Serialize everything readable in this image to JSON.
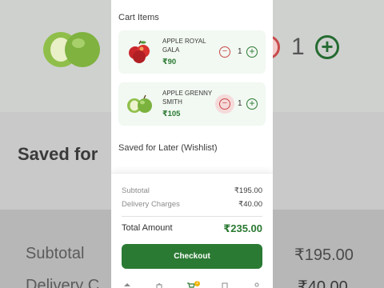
{
  "cart": {
    "section_title": "Cart Items",
    "items": [
      {
        "name": "APPLE ROYAL GALA",
        "price": "₹90",
        "quantity": "1",
        "thumb_icon": "red-apples-icon"
      },
      {
        "name": "APPLE GRENNY SMITH",
        "price": "₹105",
        "quantity": "1",
        "thumb_icon": "green-apples-icon"
      }
    ]
  },
  "wishlist": {
    "section_title": "Saved for Later (Wishlist)"
  },
  "summary": {
    "subtotal_label": "Subtotal",
    "subtotal_value": "₹195.00",
    "delivery_label": "Delivery Charges",
    "delivery_value": "₹40.00",
    "total_label": "Total Amount",
    "total_value": "₹235.00",
    "checkout_label": "Checkout"
  },
  "tabbar": {
    "tabs": [
      "home-icon",
      "shop-bag-icon",
      "cart-icon",
      "orders-icon",
      "profile-icon"
    ],
    "cart_badge": "2"
  },
  "background_zoom": {
    "saved_text": "Saved for",
    "quantity": "1",
    "subtotal_label": "Subtotal",
    "subtotal_value": "₹195.00",
    "delivery_label": "Delivery C",
    "delivery_value": "₹40.00"
  },
  "colors": {
    "brand_green": "#2b7a33",
    "minus_red": "#c94a4a",
    "card_bg": "#f2f8f2"
  }
}
